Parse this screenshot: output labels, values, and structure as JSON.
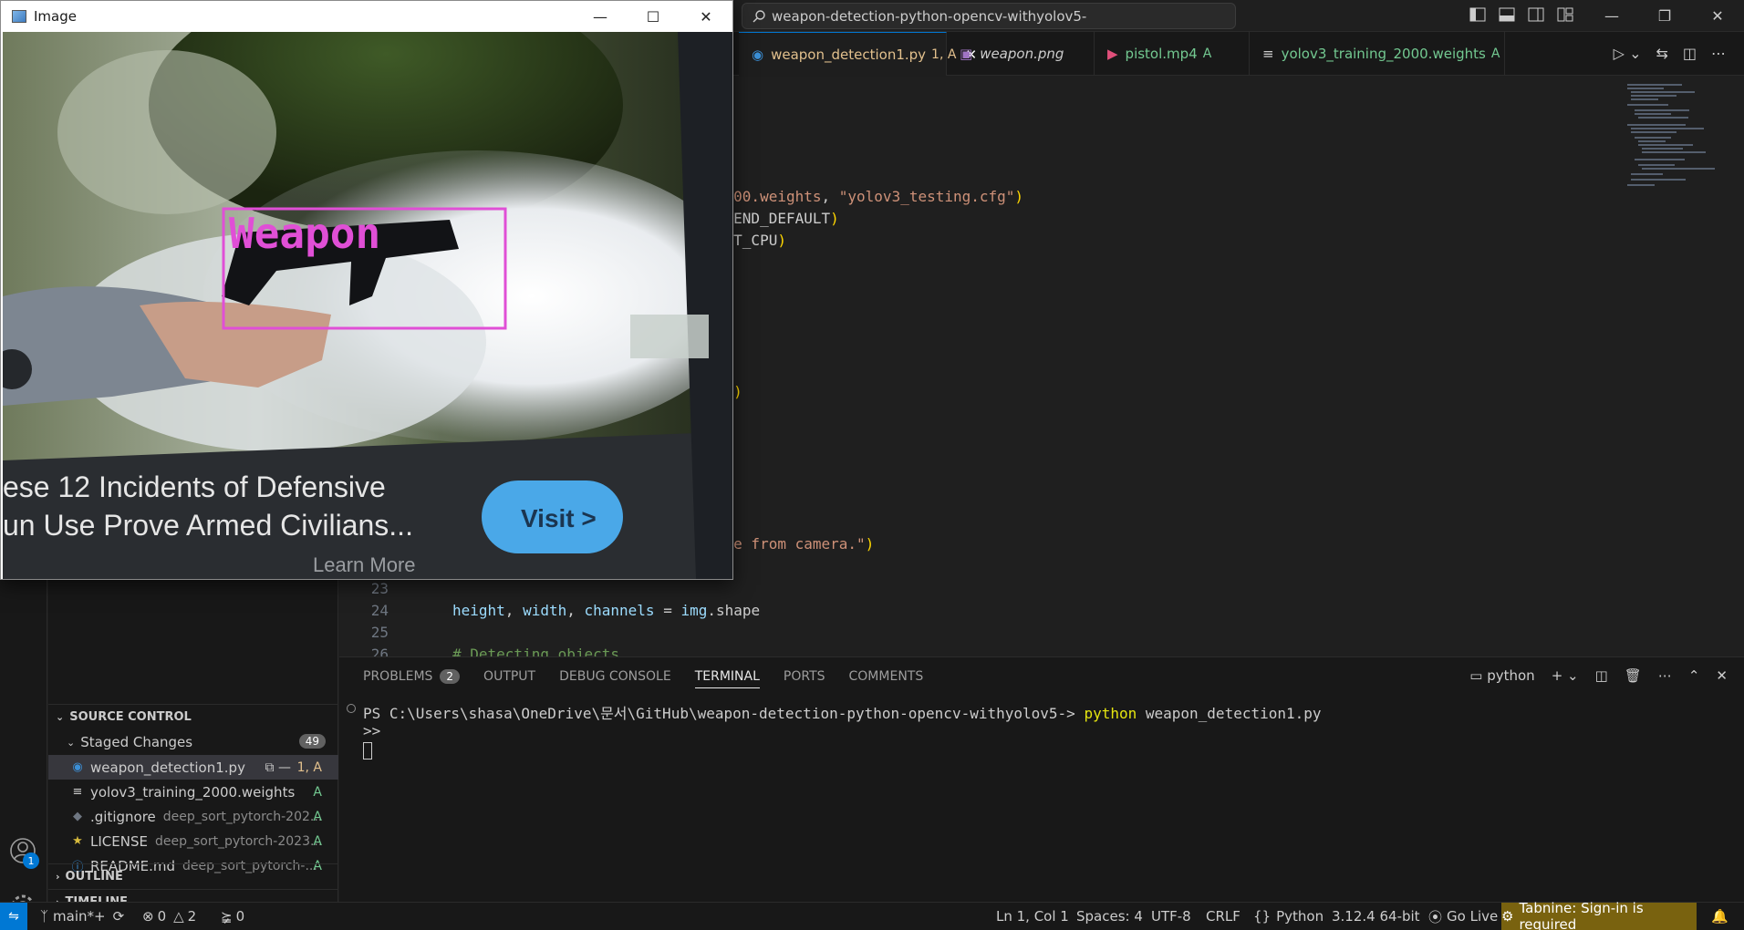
{
  "titlebar": {
    "search_text": "weapon-detection-python-opencv-withyolov5-"
  },
  "image_window": {
    "title": "Image",
    "detection_label": "Weapon",
    "ad_line1": "ese 12 Incidents of Defensive",
    "ad_line2": "un Use Prove Armed Civilians...",
    "ad_line3": "Learn More",
    "ad_button": "Visit >"
  },
  "tabs": [
    {
      "label": "weapon_detection1.py",
      "tag": "1, A"
    },
    {
      "label": "weapon.png",
      "tag": ""
    },
    {
      "label": "pistol.mp4",
      "tag": "A"
    },
    {
      "label": "yolov3_training_2000.weights",
      "tag": "A"
    }
  ],
  "editor": {
    "lines": [
      {
        "num": "",
        "segments": [
          {
            "t": "ng_2000.weights",
            "c": "str"
          },
          {
            "t": ", ",
            "c": "plain"
          },
          {
            "t": "\"yolov3_testing.cfg\"",
            "c": "str"
          },
          {
            "t": ")",
            "c": "paren"
          }
        ]
      },
      {
        "num": "",
        "segments": [
          {
            "t": "_BACKEND_DEFAULT",
            "c": "plain"
          },
          {
            "t": ")",
            "c": "paren"
          }
        ]
      },
      {
        "num": "",
        "segments": [
          {
            "t": "TARGET_CPU",
            "c": "plain"
          },
          {
            "t": ")",
            "c": "paren"
          }
        ]
      },
      {
        "num": "",
        "segments": [
          {
            "t": "era.\"",
            "c": "str"
          },
          {
            "t": ")",
            "c": "paren"
          }
        ]
      },
      {
        "num": "",
        "segments": [
          {
            "t": " frame from camera.\"",
            "c": "str"
          },
          {
            "t": ")",
            "c": "paren"
          }
        ]
      },
      {
        "num": "23",
        "segments": []
      },
      {
        "num": "24",
        "segments": [
          {
            "t": "height",
            "c": "var"
          },
          {
            "t": ", ",
            "c": "plain"
          },
          {
            "t": "width",
            "c": "var"
          },
          {
            "t": ", ",
            "c": "plain"
          },
          {
            "t": "channels",
            "c": "var"
          },
          {
            "t": " = ",
            "c": "plain"
          },
          {
            "t": "img",
            "c": "var"
          },
          {
            "t": ".shape",
            "c": "plain"
          }
        ]
      },
      {
        "num": "25",
        "segments": []
      },
      {
        "num": "26",
        "segments": [
          {
            "t": "# Detecting objects",
            "c": "cmt"
          }
        ]
      }
    ]
  },
  "sidebar": {
    "source_control_label": "SOURCE CONTROL",
    "staged_label": "Staged Changes",
    "staged_count": "49",
    "files": [
      {
        "name": "weapon_detection1.py",
        "desc": "",
        "status": "1, A",
        "icon": "python-icon"
      },
      {
        "name": "yolov3_training_2000.weights",
        "desc": "",
        "status": "A",
        "icon": "file-lines-icon"
      },
      {
        "name": ".gitignore",
        "desc": "deep_sort_pytorch-202...",
        "status": "A",
        "icon": "git-icon"
      },
      {
        "name": "LICENSE",
        "desc": "deep_sort_pytorch-2023...",
        "status": "A",
        "icon": "license-icon"
      },
      {
        "name": "README.md",
        "desc": "deep_sort_pytorch-...",
        "status": "A",
        "icon": "info-icon"
      }
    ],
    "outline_label": "OUTLINE",
    "timeline_label": "TIMELINE"
  },
  "activity": {
    "account_badge": "1"
  },
  "panel": {
    "tabs": [
      "PROBLEMS",
      "OUTPUT",
      "DEBUG CONSOLE",
      "TERMINAL",
      "PORTS",
      "COMMENTS"
    ],
    "problems_count": "2",
    "shell_label": "python",
    "prompt": "PS C:\\Users\\shasa\\OneDrive\\문서\\GitHub\\weapon-detection-python-opencv-withyolov5-> ",
    "command": "python",
    "command_arg": " weapon_detection1.py",
    "line2": ">>"
  },
  "statusbar": {
    "branch": "main*+",
    "errors": "0",
    "warnings": "2",
    "ports": "0",
    "position": "Ln 1, Col 1",
    "spaces": "Spaces: 4",
    "encoding": "UTF-8",
    "eol": "CRLF",
    "language": "Python",
    "interpreter": "3.12.4 64-bit",
    "golive": "Go Live",
    "tabnine": "Tabnine: Sign-in is required"
  },
  "colors": {
    "accent": "#0078d4",
    "detection_box": "#e04fd6",
    "git_added": "#73c991",
    "git_modified": "#e2c08d",
    "tabnine_bg": "#79620f"
  }
}
